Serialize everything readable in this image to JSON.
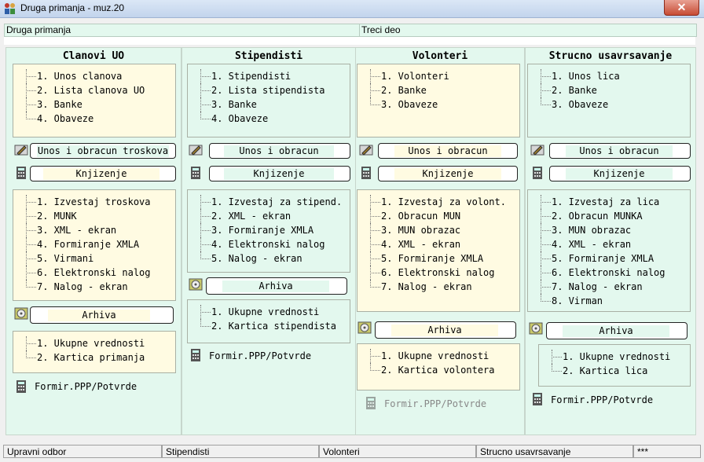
{
  "window": {
    "title": "Druga primanja - muz.20",
    "close_glyph": "✕"
  },
  "header": {
    "left": "Druga primanja",
    "right": "Treci deo"
  },
  "columns": [
    {
      "title": "Clanovi UO",
      "menu1": [
        "1. Unos clanova",
        "2. Lista clanova UO",
        "3. Banke",
        "4. Obaveze"
      ],
      "btn_entry": "Unos i obracun troskova",
      "btn_booking": "Knjizenje",
      "menu2": [
        "1. Izvestaj troskova",
        "2. MUNK",
        "3. XML - ekran",
        "4. Formiranje XMLA",
        "5. Virmani",
        "6. Elektronski nalog",
        "7. Nalog - ekran"
      ],
      "btn_archive": "Arhiva",
      "menu3": [
        "1. Ukupne vrednosti",
        "2. Kartica primanja"
      ],
      "ppp": "Formir.PPP/Potvrde"
    },
    {
      "title": "Stipendisti",
      "menu1": [
        "1. Stipendisti",
        "2. Lista stipendista",
        "3. Banke",
        "4. Obaveze"
      ],
      "btn_entry": "Unos i obracun",
      "btn_booking": "Knjizenje",
      "menu2": [
        "1. Izvestaj za stipend.",
        "2. XML - ekran",
        "3. Formiranje XMLA",
        "4. Elektronski nalog",
        "5. Nalog - ekran"
      ],
      "btn_archive": "Arhiva",
      "menu3": [
        "1. Ukupne vrednosti",
        "2. Kartica stipendista"
      ],
      "ppp": "Formir.PPP/Potvrde"
    },
    {
      "title": "Volonteri",
      "menu1": [
        "1. Volonteri",
        "2. Banke",
        "3. Obaveze"
      ],
      "btn_entry": "Unos i obracun",
      "btn_booking": "Knjizenje",
      "menu2": [
        "1. Izvestaj za volont.",
        "2. Obracun MUN",
        "3. MUN obrazac",
        "4. XML - ekran",
        "5. Formiranje XMLA",
        "6. Elektronski nalog",
        "7. Nalog - ekran"
      ],
      "btn_archive": "Arhiva",
      "menu3": [
        "1. Ukupne vrednosti",
        "2. Kartica volontera"
      ],
      "ppp": "Formir.PPP/Potvrde"
    },
    {
      "title": "Strucno usavrsavanje",
      "menu1": [
        "1. Unos lica",
        "2. Banke",
        "3. Obaveze"
      ],
      "btn_entry": "Unos i obracun",
      "btn_booking": "Knjizenje",
      "menu2": [
        "1. Izvestaj za lica",
        "2. Obracun MUNKA",
        "3. MUN obrazac",
        "4. XML - ekran",
        "5. Formiranje XMLA",
        "6. Elektronski nalog",
        "7. Nalog - ekran",
        "8. Virman"
      ],
      "btn_archive": "Arhiva",
      "menu3": [
        "1. Ukupne vrednosti",
        "2. Kartica lica"
      ],
      "ppp": "Formir.PPP/Potvrde"
    }
  ],
  "status": [
    "Upravni odbor",
    "Stipendisti",
    "Volonteri",
    "Strucno usavrsavanje",
    "***"
  ],
  "colors": {
    "panel": "#e3f8ee",
    "menu_bg": "#fffbe2",
    "disabled_text": "#888888"
  },
  "icons": {
    "app": "people-icon",
    "entry": "pencil-icon",
    "booking": "calculator-icon",
    "archive": "disk-icon",
    "ppp": "calculator-icon"
  }
}
